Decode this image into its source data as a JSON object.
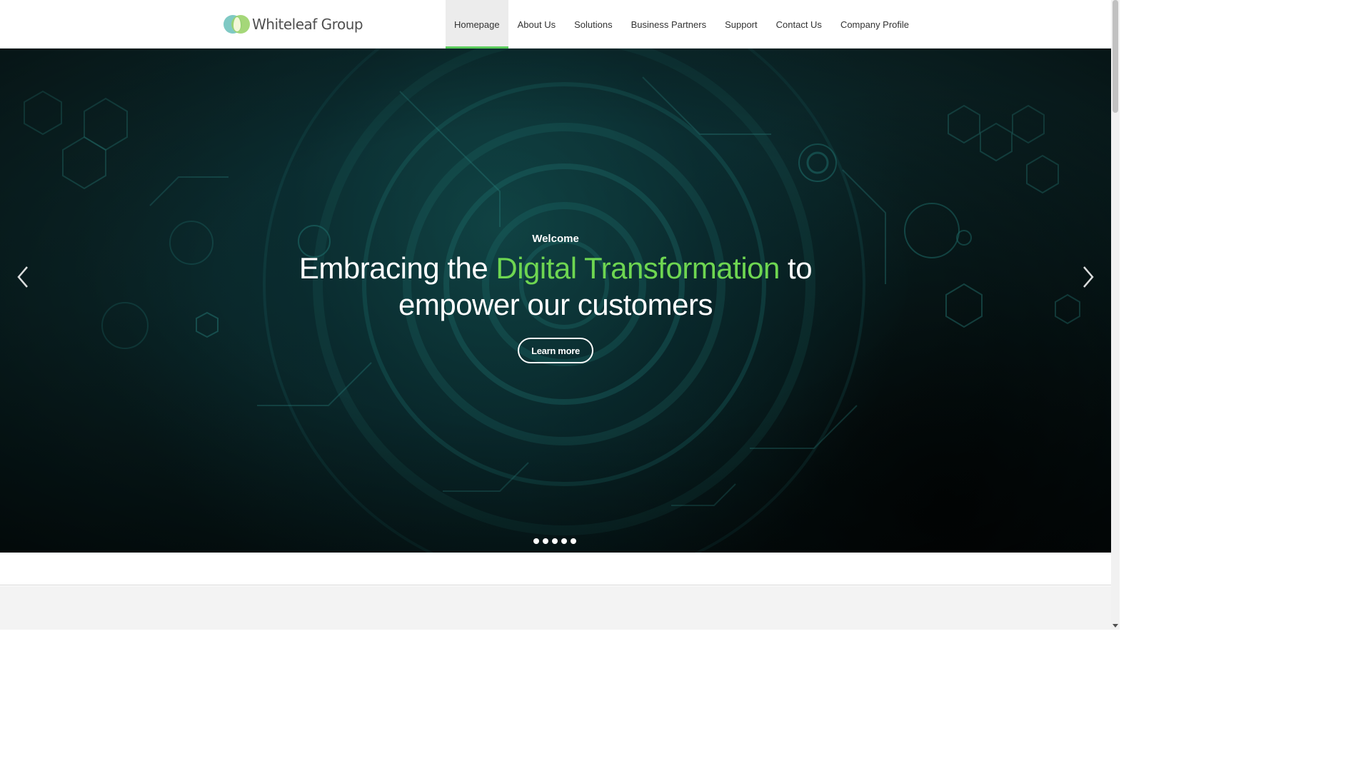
{
  "brand": {
    "name": "Whiteleaf Group"
  },
  "nav": {
    "items": [
      {
        "label": "Homepage",
        "active": true
      },
      {
        "label": "About Us"
      },
      {
        "label": "Solutions"
      },
      {
        "label": "Business Partners"
      },
      {
        "label": "Support"
      },
      {
        "label": "Contact Us"
      },
      {
        "label": "Company Profile"
      }
    ]
  },
  "hero": {
    "eyebrow": "Welcome",
    "headline_before": "Embracing the ",
    "headline_highlight": "Digital Transformation",
    "headline_after": " to empower our customers",
    "cta_label": "Learn more",
    "slide_count": 5,
    "highlight_color": "#6ed651"
  },
  "colors": {
    "accent": "#5ccc5c",
    "hero_bg": "#0b2628"
  },
  "icons": {
    "prev": "chevron-left-icon",
    "next": "chevron-right-icon"
  }
}
